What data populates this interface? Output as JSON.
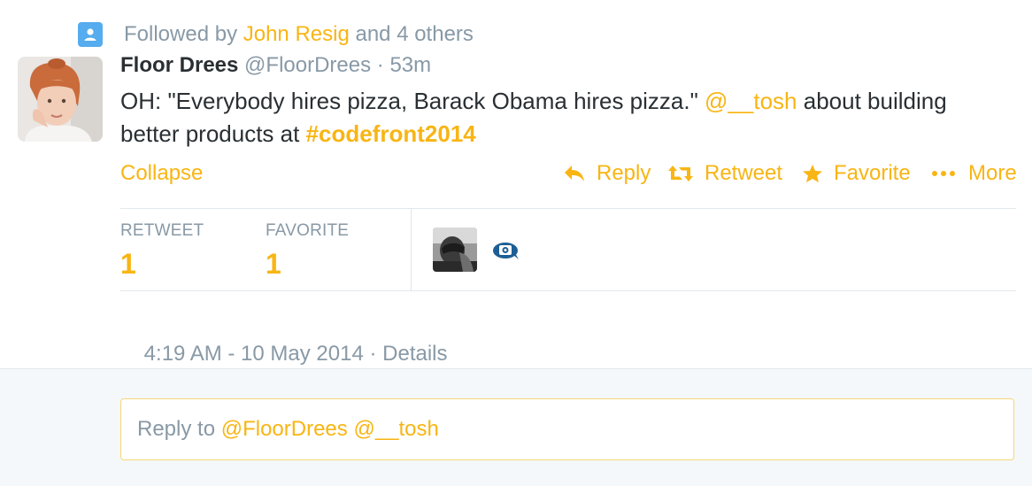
{
  "colors": {
    "accent": "#f8b513",
    "muted": "#8899a6",
    "text": "#292f33",
    "context_icon": "#55acee"
  },
  "context": {
    "icon": "user-icon",
    "prefix": "Followed by ",
    "user": "John Resig",
    "suffix": " and 4 others"
  },
  "tweet": {
    "name": "Floor Drees",
    "handle": "@FloorDrees",
    "separator": " · ",
    "time": "53m",
    "text": {
      "part1": "OH: \"Everybody hires pizza, Barack Obama hires pizza.\" ",
      "mention": "@__tosh",
      "part2": " about building better products at ",
      "hashtag": "#codefront2014"
    }
  },
  "actions": {
    "collapse": "Collapse",
    "reply": "Reply",
    "retweet": "Retweet",
    "favorite": "Favorite",
    "more": "More"
  },
  "stats": {
    "retweet_label": "RETWEET",
    "retweet_count": "1",
    "favorite_label": "FAVORITE",
    "favorite_count": "1"
  },
  "meta": {
    "timestamp": "4:19 AM - 10 May 2014",
    "separator": " · ",
    "details": "Details"
  },
  "reply": {
    "prefix": "Reply to ",
    "mention1": "@FloorDrees",
    "space": " ",
    "mention2": "@__tosh"
  }
}
